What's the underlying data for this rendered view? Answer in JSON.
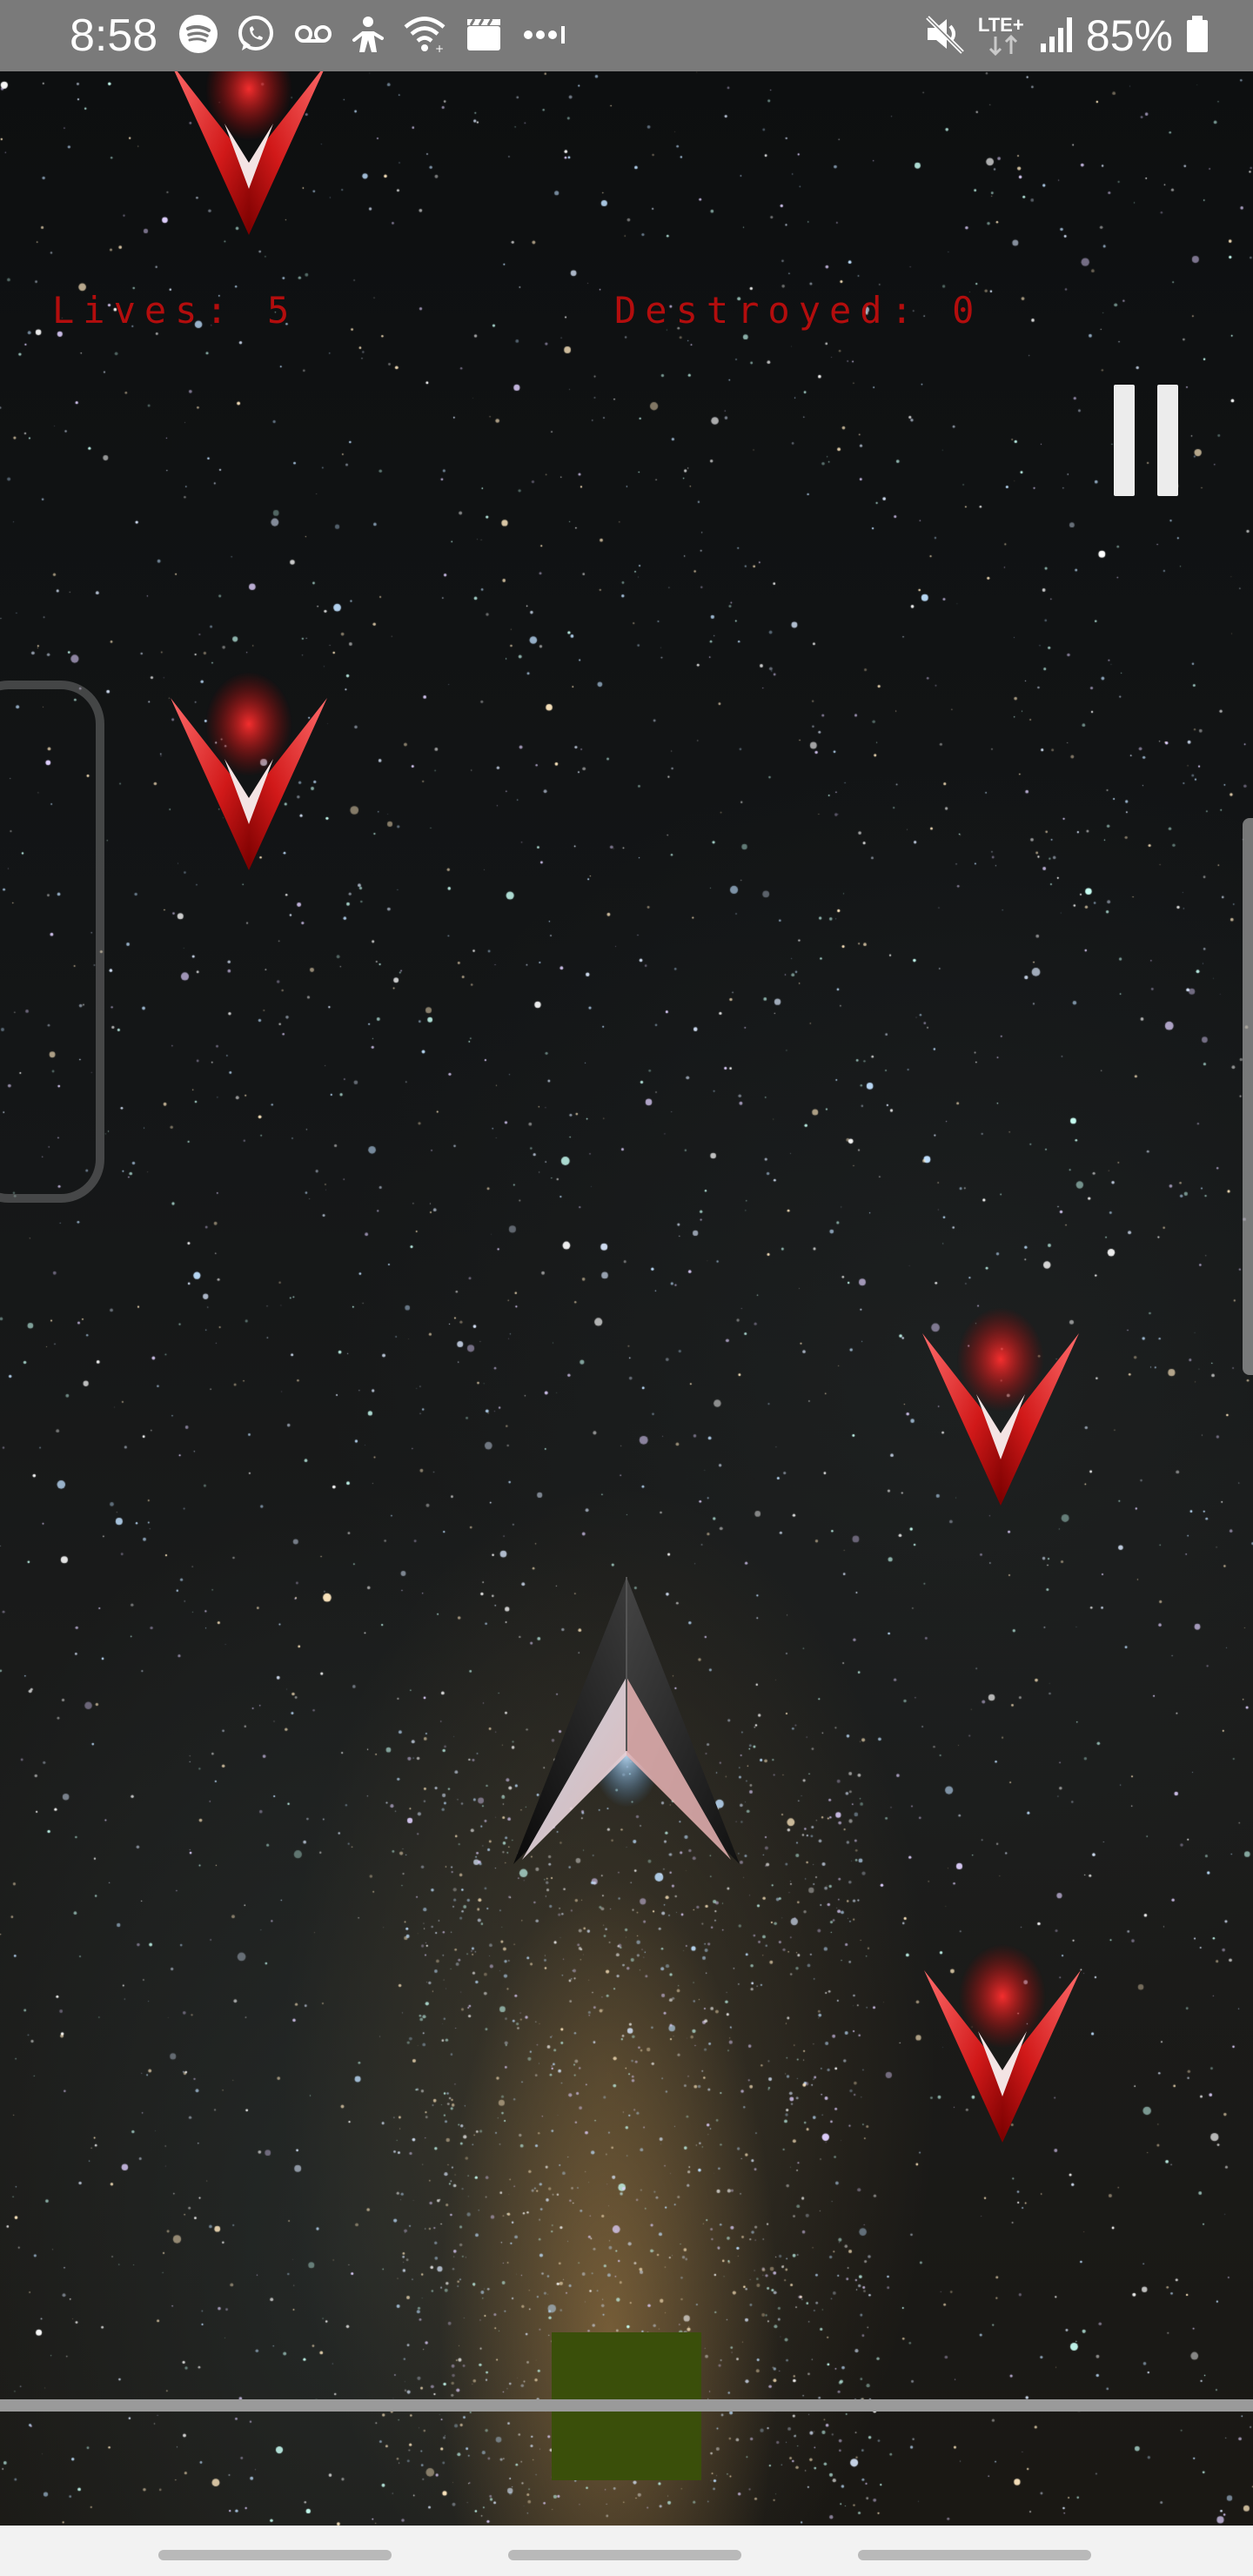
{
  "status_bar": {
    "time": "8:58",
    "left_icons": [
      "spotify-icon",
      "whatsapp-icon",
      "voicemail-icon",
      "notification-figure-icon",
      "wifi-icon",
      "clapperboard-icon",
      "more-dots-icon"
    ],
    "right_icons": [
      "mute-icon",
      "lte-icon",
      "signal-icon",
      "battery-icon"
    ],
    "network_label": "LTE+",
    "battery_percent": "85%"
  },
  "hud": {
    "lives_text": "Lives: 5",
    "destroyed_text": "Destroyed: 0",
    "lives": 5,
    "destroyed": 0
  },
  "controls": {
    "pause_icon": "pause-icon"
  },
  "colors": {
    "hud_text": "#b30d0d",
    "enemy_ship": "#d21c1c",
    "player_ship": "#1a1a1a",
    "launch_pad": "#3a4f0a",
    "status_bar_bg": "#7a7a7a"
  },
  "sprites": {
    "enemies": [
      "enemy-ship",
      "enemy-ship",
      "enemy-ship",
      "enemy-ship"
    ],
    "player": "player-ship"
  }
}
